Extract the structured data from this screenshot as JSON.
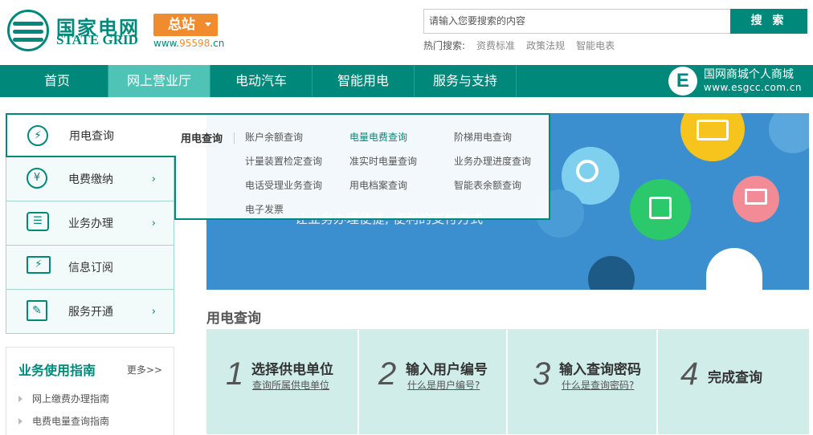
{
  "header": {
    "logo_cn": "国家电网",
    "logo_en": "STATE GRID",
    "zhanzhan_label": "总站",
    "site_prefix": "www.",
    "site_number": "95598",
    "site_suffix": ".cn",
    "search": {
      "placeholder": "请输入您要搜索的内容",
      "button_label": "搜 索"
    },
    "hot_search": {
      "label": "热门搜索:",
      "items": [
        "资费标准",
        "政策法规",
        "智能电表"
      ]
    }
  },
  "nav": {
    "items": [
      "首页",
      "网上营业厅",
      "电动汽车",
      "智能用电",
      "服务与支持"
    ],
    "active_index": 1,
    "mall": {
      "letter": "E",
      "title": "国网商城个人商城",
      "url": "www.esgcc.com.cn"
    }
  },
  "sidebar": {
    "items": [
      {
        "label": "用电查询",
        "icon": "search-bolt-icon",
        "glyph": "⚡"
      },
      {
        "label": "电费缴纳",
        "icon": "coins-icon",
        "glyph": "¥",
        "chevron": "›"
      },
      {
        "label": "业务办理",
        "icon": "chat-icon",
        "glyph": "☰",
        "chevron": "›"
      },
      {
        "label": "信息订阅",
        "icon": "monitor-bolt-icon",
        "glyph": "⚡"
      },
      {
        "label": "服务开通",
        "icon": "edit-icon",
        "glyph": "✎",
        "chevron": "›"
      }
    ],
    "active_index": 0
  },
  "dropdown": {
    "title": "用电查询",
    "links": [
      "账户余额查询",
      "电量电费查询",
      "阶梯用电查询",
      "计量装置检定查询",
      "准实时电量查询",
      "业务办理进度查询",
      "电话受理业务查询",
      "用电档案查询",
      "智能表余额查询",
      "电子发票"
    ],
    "highlight_index": 1
  },
  "banner": {
    "partial_text": "让业务办理便捷, 便利的支付方式"
  },
  "section": {
    "title": "用电查询"
  },
  "steps": [
    {
      "num": "1",
      "title": "选择供电单位",
      "link": "查询所属供电单位"
    },
    {
      "num": "2",
      "title": "输入用户编号",
      "link": "什么是用户编号?"
    },
    {
      "num": "3",
      "title": "输入查询密码",
      "link": "什么是查询密码?"
    },
    {
      "num": "4",
      "title": "完成查询",
      "link": ""
    }
  ],
  "guide": {
    "title": "业务使用指南",
    "more": "更多>>",
    "items": [
      "网上缴费办理指南",
      "电费电量查询指南"
    ]
  },
  "colors": {
    "brand": "#00897b",
    "accent": "#f08c2e",
    "nav_active": "#4fc3b6",
    "banner": "#3b8fce",
    "steps_bg": "#d0ede9"
  }
}
